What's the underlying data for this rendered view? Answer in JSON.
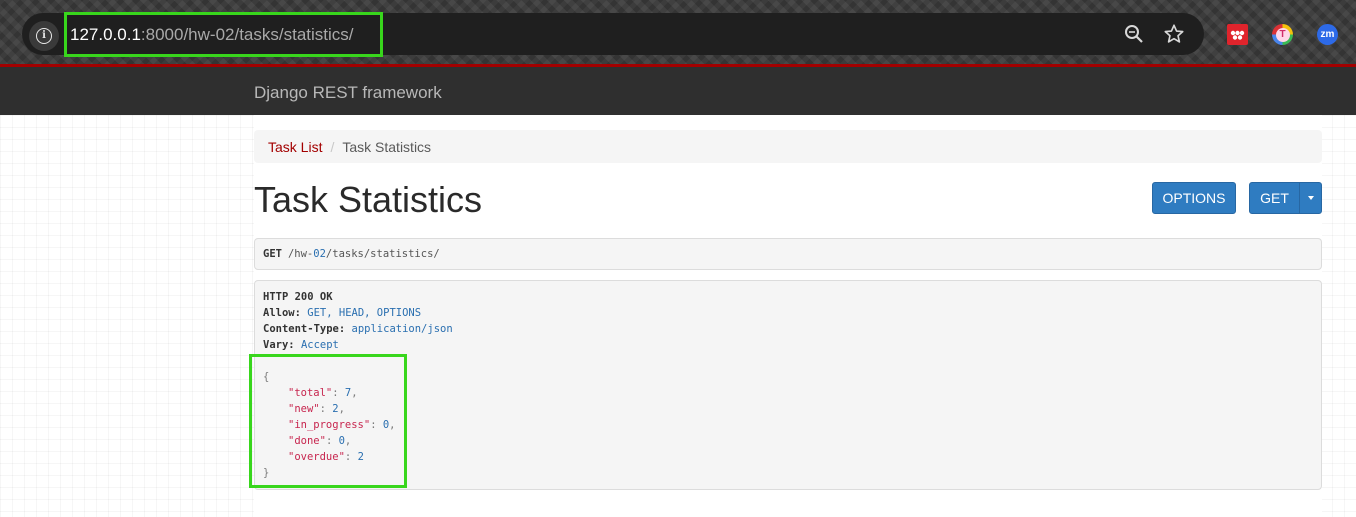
{
  "browser": {
    "url_host": "127.0.0.1",
    "url_rest": ":8000/hw-02/tasks/statistics/",
    "icons": [
      "info-icon",
      "zoom-icon",
      "star-icon",
      "mendeley-extension-icon",
      "t-extension-icon",
      "zoom-extension-icon"
    ],
    "ext3_label": "zm",
    "ext2_label": "T",
    "highlight_color": "#38d61c"
  },
  "navbar": {
    "brand": "Django REST framework",
    "accent": "#a30000"
  },
  "breadcrumb": {
    "items": [
      {
        "label": "Task List",
        "link": true
      },
      {
        "label": "Task Statistics",
        "link": false
      }
    ],
    "separator": "/"
  },
  "page": {
    "title": "Task Statistics",
    "buttons": {
      "options": "OPTIONS",
      "get": "GET"
    },
    "button_color": "#2f7cc1"
  },
  "request": {
    "method": "GET",
    "path_prefix": "/hw-",
    "path_accent": "02",
    "path_suffix": "/tasks/statistics/"
  },
  "response": {
    "status": "HTTP 200 OK",
    "headers": [
      {
        "name": "Allow:",
        "value": "GET, HEAD, OPTIONS"
      },
      {
        "name": "Content-Type:",
        "value": "application/json"
      },
      {
        "name": "Vary:",
        "value": "Accept"
      }
    ],
    "json_open": "{",
    "json_close": "}",
    "json": [
      {
        "key": "\"total\"",
        "value": "7",
        "comma": ","
      },
      {
        "key": "\"new\"",
        "value": "2",
        "comma": ","
      },
      {
        "key": "\"in_progress\"",
        "value": "0",
        "comma": ","
      },
      {
        "key": "\"done\"",
        "value": "0",
        "comma": ","
      },
      {
        "key": "\"overdue\"",
        "value": "2",
        "comma": ""
      }
    ]
  }
}
